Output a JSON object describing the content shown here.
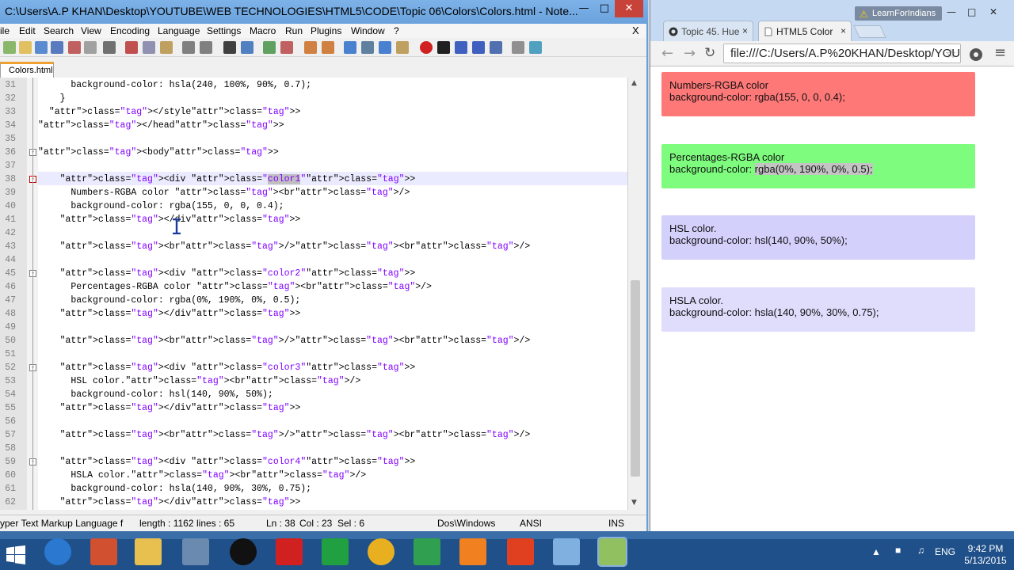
{
  "notepad": {
    "title": "C:\\Users\\A.P KHAN\\Desktop\\YOUTUBE\\WEB TECHNOLOGIES\\HTML5\\CODE\\Topic 06\\Colors\\Colors.html - Note...",
    "menu": [
      "ile",
      "Edit",
      "Search",
      "View",
      "Encoding",
      "Language",
      "Settings",
      "Macro",
      "Run",
      "Plugins",
      "Window",
      "?"
    ],
    "close_doc": "X",
    "tab": "Colors.html",
    "status": {
      "file_type": "yper Text Markup Language f",
      "length": "length : 1162",
      "lines": "lines : 65",
      "position": "Ln : 38",
      "column": "Col : 23",
      "selection": "Sel : 6",
      "eol": "Dos\\Windows",
      "encoding": "ANSI",
      "mode": "INS"
    },
    "lines": [
      {
        "n": "31",
        "t": "      background-color: hsla(240, 100%, 90%, 0.7);"
      },
      {
        "n": "32",
        "t": "    }"
      },
      {
        "n": "33",
        "t": "  </style>"
      },
      {
        "n": "34",
        "t": "</head>"
      },
      {
        "n": "35",
        "t": ""
      },
      {
        "n": "36",
        "t": "<body>"
      },
      {
        "n": "37",
        "t": ""
      },
      {
        "n": "38",
        "t": "    <div class=\"color1\">"
      },
      {
        "n": "39",
        "t": "      Numbers-RGBA color <br/>"
      },
      {
        "n": "40",
        "t": "      background-color: rgba(155, 0, 0, 0.4);"
      },
      {
        "n": "41",
        "t": "    </div>"
      },
      {
        "n": "42",
        "t": ""
      },
      {
        "n": "43",
        "t": "    <br/><br/>"
      },
      {
        "n": "44",
        "t": ""
      },
      {
        "n": "45",
        "t": "    <div class=\"color2\">"
      },
      {
        "n": "46",
        "t": "      Percentages-RGBA color <br/>"
      },
      {
        "n": "47",
        "t": "      background-color: rgba(0%, 190%, 0%, 0.5);"
      },
      {
        "n": "48",
        "t": "    </div>"
      },
      {
        "n": "49",
        "t": ""
      },
      {
        "n": "50",
        "t": "    <br/><br/>"
      },
      {
        "n": "51",
        "t": ""
      },
      {
        "n": "52",
        "t": "    <div class=\"color3\">"
      },
      {
        "n": "53",
        "t": "      HSL color.<br/>"
      },
      {
        "n": "54",
        "t": "      background-color: hsl(140, 90%, 50%);"
      },
      {
        "n": "55",
        "t": "    </div>"
      },
      {
        "n": "56",
        "t": ""
      },
      {
        "n": "57",
        "t": "    <br/><br/>"
      },
      {
        "n": "58",
        "t": ""
      },
      {
        "n": "59",
        "t": "    <div class=\"color4\">"
      },
      {
        "n": "60",
        "t": "      HSLA color.<br/>"
      },
      {
        "n": "61",
        "t": "      background-color: hsla(140, 90%, 30%, 0.75);"
      },
      {
        "n": "62",
        "t": "    </div>"
      }
    ]
  },
  "chrome": {
    "user_label": "LearnForIndians",
    "tabs": [
      {
        "label": "Topic 45. Hue"
      },
      {
        "label": "HTML5 Color"
      }
    ],
    "tab_close": "×",
    "address": "file:///C:/Users/A.P%20KHAN/Desktop/YOUTUBE",
    "boxes": [
      {
        "title": "Numbers-RGBA color",
        "code": "background-color: rgba(155, 0, 0, 0.4);",
        "bg": "#ff7878"
      },
      {
        "title": "Percentages-RGBA color",
        "code": "background-color: ",
        "highlight": "rgba(0%, 190%, 0%, 0.5);",
        "bg": "#7dfc7d"
      },
      {
        "title": "HSL color.",
        "code": "background-color: hsl(140, 90%, 50%);",
        "bg": "#d4d0fc"
      },
      {
        "title": "HSLA color.",
        "code": "background-color: hsla(140, 90%, 30%, 0.75);",
        "bg": "#e0dcfc"
      }
    ]
  },
  "taskbar": {
    "language": "ENG",
    "time": "9:42 PM",
    "date": "5/13/2015"
  }
}
